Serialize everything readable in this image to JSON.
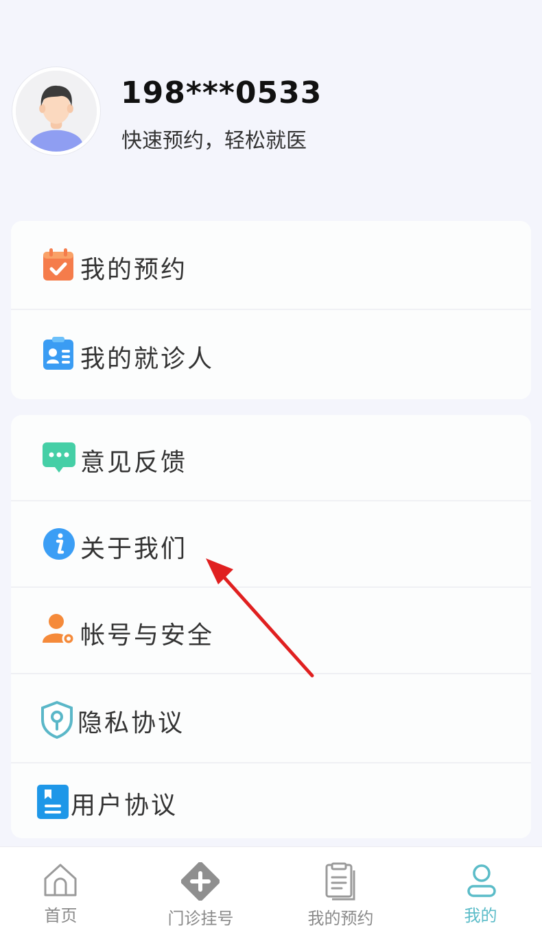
{
  "profile": {
    "phone": "198***0533",
    "slogan": "快速预约，轻松就医",
    "avatar_icon": "user-avatar-icon"
  },
  "menu_group_1": [
    {
      "label": "我的预约",
      "icon": "calendar-check-icon",
      "color": "#f57c4b"
    },
    {
      "label": "我的就诊人",
      "icon": "patient-card-icon",
      "color": "#3a9cf3"
    }
  ],
  "menu_group_2": [
    {
      "label": "意见反馈",
      "icon": "chat-bubble-icon",
      "color": "#45cfa6"
    },
    {
      "label": "关于我们",
      "icon": "info-icon",
      "color": "#3b9ef5"
    },
    {
      "label": "帐号与安全",
      "icon": "user-gear-icon",
      "color": "#f58a3a"
    },
    {
      "label": "隐私协议",
      "icon": "shield-keyhole-icon",
      "color": "#5ab7c8"
    },
    {
      "label": "用户协议",
      "icon": "document-icon",
      "color": "#1e97e8"
    }
  ],
  "tabbar": {
    "items": [
      {
        "label": "首页",
        "icon": "home-icon",
        "active": false
      },
      {
        "label": "门诊挂号",
        "icon": "medical-plus-icon",
        "active": false
      },
      {
        "label": "我的预约",
        "icon": "clipboard-icon",
        "active": false
      },
      {
        "label": "我的",
        "icon": "person-icon",
        "active": true
      }
    ],
    "active_color": "#5bbcc8",
    "inactive_color": "#8a8a8a"
  },
  "annotation": {
    "type": "arrow",
    "color": "#e02020"
  }
}
